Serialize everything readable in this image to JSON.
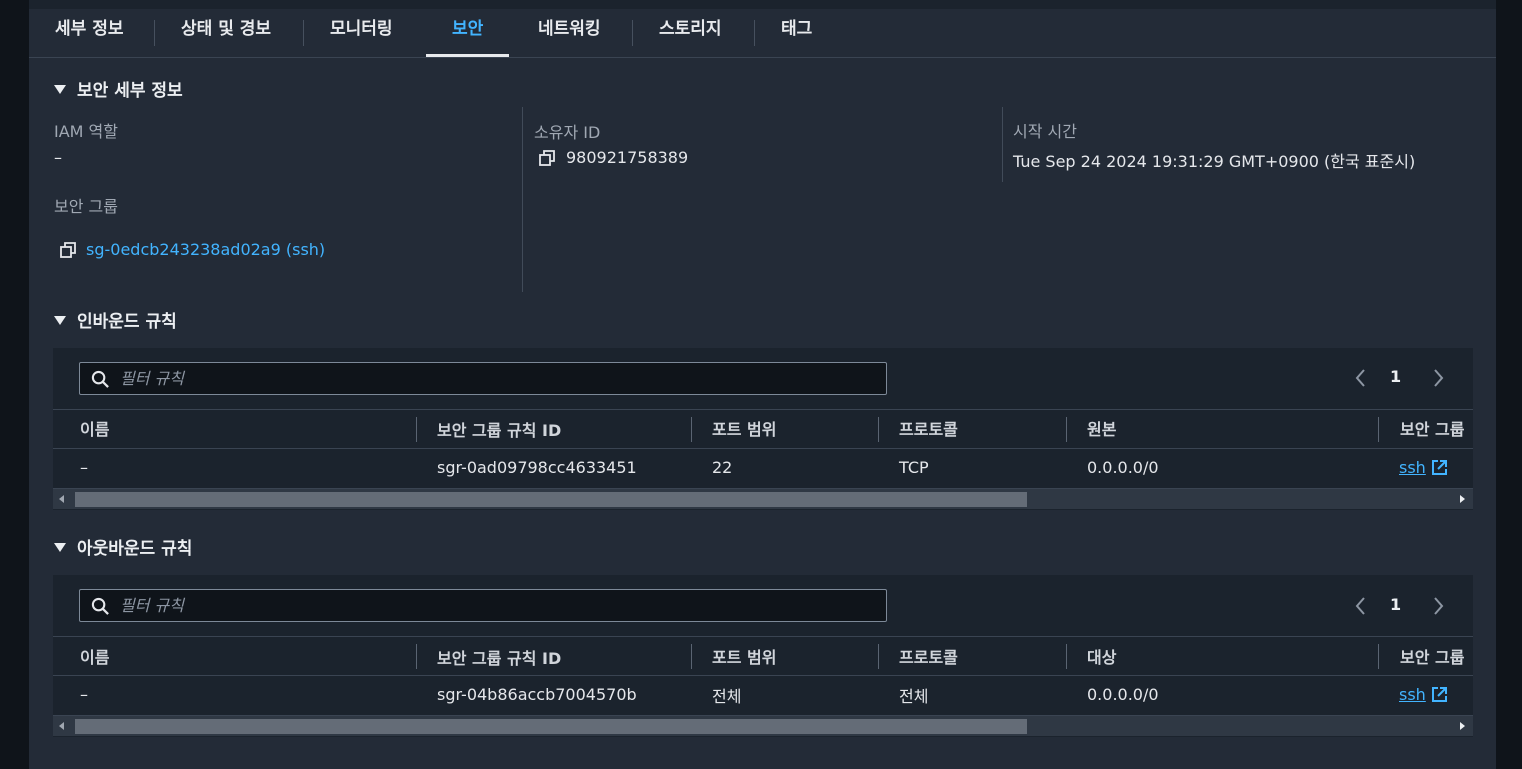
{
  "tabs": [
    {
      "label": "세부 정보"
    },
    {
      "label": "상태 및 경보"
    },
    {
      "label": "모니터링"
    },
    {
      "label": "보안",
      "active": true
    },
    {
      "label": "네트워킹"
    },
    {
      "label": "스토리지"
    },
    {
      "label": "태그"
    }
  ],
  "security_details": {
    "title": "보안 세부 정보",
    "iam_role_label": "IAM 역할",
    "iam_role_value": "–",
    "owner_id_label": "소유자 ID",
    "owner_id_value": "980921758389",
    "launch_time_label": "시작 시간",
    "launch_time_value": "Tue Sep 24 2024 19:31:29 GMT+0900 (한국 표준시)",
    "security_groups_label": "보안 그룹",
    "security_group_link": "sg-0edcb243238ad02a9 (ssh)"
  },
  "inbound": {
    "title": "인바운드 규칙",
    "filter_placeholder": "필터 규칙",
    "page": "1",
    "columns": [
      "이름",
      "보안 그룹 규칙 ID",
      "포트 범위",
      "프로토콜",
      "원본",
      "보안 그룹"
    ],
    "rows": [
      {
        "name": "–",
        "rule_id": "sgr-0ad09798cc4633451",
        "port_range": "22",
        "protocol": "TCP",
        "source": "0.0.0.0/0",
        "security_group": "ssh"
      }
    ]
  },
  "outbound": {
    "title": "아웃바운드 규칙",
    "filter_placeholder": "필터 규칙",
    "page": "1",
    "columns": [
      "이름",
      "보안 그룹 규칙 ID",
      "포트 범위",
      "프로토콜",
      "대상",
      "보안 그룹"
    ],
    "rows": [
      {
        "name": "–",
        "rule_id": "sgr-04b86accb7004570b",
        "port_range": "전체",
        "protocol": "전체",
        "destination": "0.0.0.0/0",
        "security_group": "ssh"
      }
    ]
  },
  "colors": {
    "accent": "#42b4ff",
    "panel": "#232b37",
    "table_bg": "#1b232d"
  },
  "icons": [
    "copy-icon",
    "search-icon",
    "chevron-left-icon",
    "chevron-right-icon",
    "external-link-icon",
    "caret-down-icon"
  ]
}
